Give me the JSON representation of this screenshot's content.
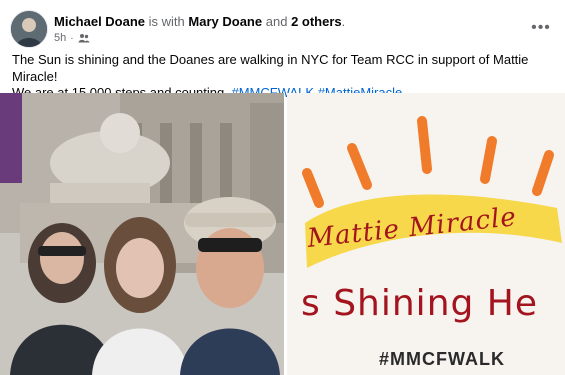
{
  "post": {
    "author": "Michael Doane",
    "with_text": "is with",
    "tagged": "Mary Doane",
    "and_text": "and",
    "others": "2 others",
    "period": ".",
    "time": "5h",
    "audience_icon": "friends-icon",
    "more_icon": "more-horizontal-icon",
    "more_label": "•••",
    "body_line1": "The Sun is shining and the Doanes are walking in NYC for Team RCC in support of Mattie Miracle!",
    "body_line2": "We are at 15,000 steps and counting.",
    "hashtag1": "#MMCFWALK",
    "hashtag2": "#MattieMiracle",
    "hashtag_color": "#0064d1"
  },
  "photos": {
    "left": {
      "description_icon": "group-selfie-photo"
    },
    "right": {
      "sign_title": "Mattie Miracle",
      "sign_line2": "s Shining He",
      "sign_hashtag": "#MMCFWALK"
    }
  }
}
